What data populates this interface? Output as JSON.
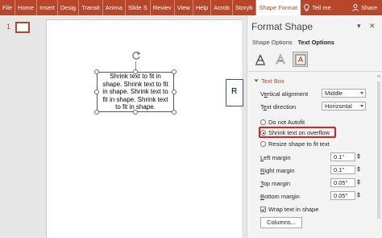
{
  "ribbon": {
    "tabs": [
      "File",
      "Home",
      "Insert",
      "Design",
      "Transitions",
      "Animations",
      "Slide Show",
      "Review",
      "View",
      "Help",
      "Acrobat",
      "Storyboard"
    ],
    "tabs_visible": [
      "File",
      "Home",
      "Insert",
      "Desig",
      "Transit",
      "Anima",
      "Slide S",
      "Reviev",
      "View",
      "Help",
      "Acrob",
      "Storyb"
    ],
    "active_tab": "Shape Format",
    "tell_me": "Tell me",
    "share": "Share",
    "accent": "#b7472a"
  },
  "thumbnails": {
    "slide_number": "1"
  },
  "slide": {
    "shape_text": "Shrink text to fit in shape. Shrink text to fit in shape. Shrink text to fit in shape. Shrink text to fit in shape.",
    "partial_shape_text": "R"
  },
  "pane": {
    "title": "Format Shape",
    "close": "✕",
    "dropdown_glyph": "▾",
    "tabs": {
      "shape_options": "Shape Options",
      "text_options": "Text Options"
    },
    "section": "Text Box",
    "vertical_alignment": {
      "label": "Vertical alignment",
      "value": "Middle"
    },
    "text_direction": {
      "label": "Text direction",
      "value": "Horizontal"
    },
    "options": {
      "do_not_autofit": "Do not Autofit",
      "shrink_on_overflow": "Shrink text on overflow",
      "resize_shape": "Resize shape to fit text",
      "selected": "shrink_on_overflow"
    },
    "margins": {
      "left": {
        "label": "Left margin",
        "value": "0.1\""
      },
      "right": {
        "label": "Right margin",
        "value": "0.1\""
      },
      "top": {
        "label": "Top margin",
        "value": "0.05\""
      },
      "bottom": {
        "label": "Bottom margin",
        "value": "0.05\""
      }
    },
    "wrap_text": {
      "label": "Wrap text in shape",
      "checked": true
    },
    "columns_button": "Columns...",
    "highlight_color": "#e02020"
  }
}
